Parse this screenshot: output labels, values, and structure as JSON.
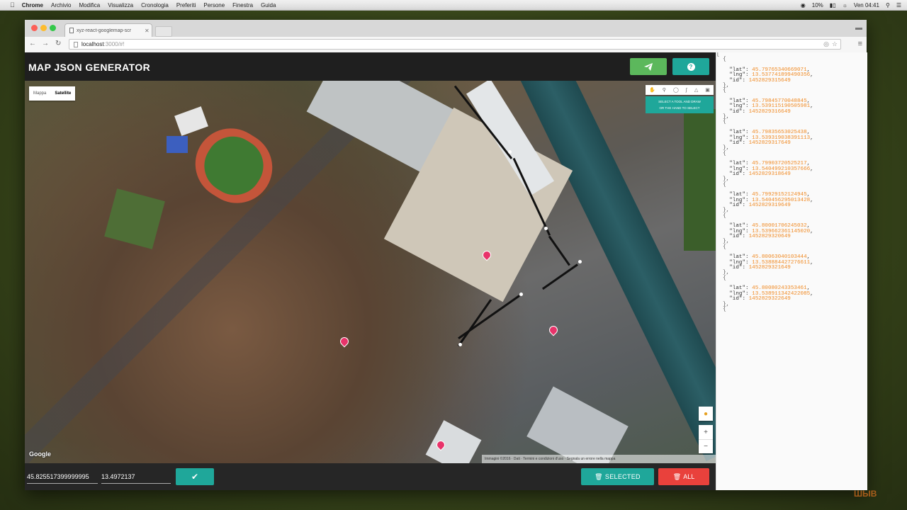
{
  "menubar": {
    "items": [
      "Chrome",
      "Archivio",
      "Modifica",
      "Visualizza",
      "Cronologia",
      "Preferiti",
      "Persone",
      "Finestra",
      "Guida"
    ],
    "battery": "10%",
    "clock": "Ven 04:41"
  },
  "browser": {
    "tab_title": "xyz-react-googlemap-scr",
    "url_host": "localhost",
    "url_path": ":3000/#!"
  },
  "app": {
    "title": "MAP JSON GENERATOR",
    "send_icon": "paper-plane-icon",
    "help_icon": "question-icon",
    "map_types": [
      "Mappa",
      "Satellite"
    ],
    "map_type_selected": "Satellite",
    "drawing_hint": [
      "SELECT A TOOL AND DRAW",
      "OR THE HAND TO SELECT"
    ],
    "google_logo": "Google",
    "map_footer": "Immagini ©2016 · Dati · Termini e condizioni d'uso · Segnala un errore nella mappa",
    "zoom_in": "+",
    "zoom_out": "−",
    "lat_value": "45.825517399999995",
    "lng_value": "13.4972137",
    "confirm_icon": "check-icon",
    "selected_label": "SELECTED",
    "all_label": "ALL",
    "colors": {
      "green": "#5cb85c",
      "teal": "#1fa79a",
      "red": "#e9413c"
    }
  },
  "json_points": [
    {
      "lat": "45.79765340669071",
      "lng": "13.537741899490356",
      "id": "1452829315649"
    },
    {
      "lat": "45.79845770048845",
      "lng": "13.539115190505981",
      "id": "1452829316649"
    },
    {
      "lat": "45.79835653025438",
      "lng": "13.539319038391113",
      "id": "1452829317649"
    },
    {
      "lat": "45.79903720525217",
      "lng": "13.540499210357666",
      "id": "1452829318649"
    },
    {
      "lat": "45.79929152124945",
      "lng": "13.540456295013428",
      "id": "1452829319649"
    },
    {
      "lat": "45.80001706245032",
      "lng": "13.539662361145020",
      "id": "1452829320649"
    },
    {
      "lat": "45.80063040103444",
      "lng": "13.538884427276611",
      "id": "1452829321649"
    },
    {
      "lat": "45.80080243353461",
      "lng": "13.538911342422085",
      "id": "1452829322649"
    }
  ],
  "watermark": "ШЫВ"
}
